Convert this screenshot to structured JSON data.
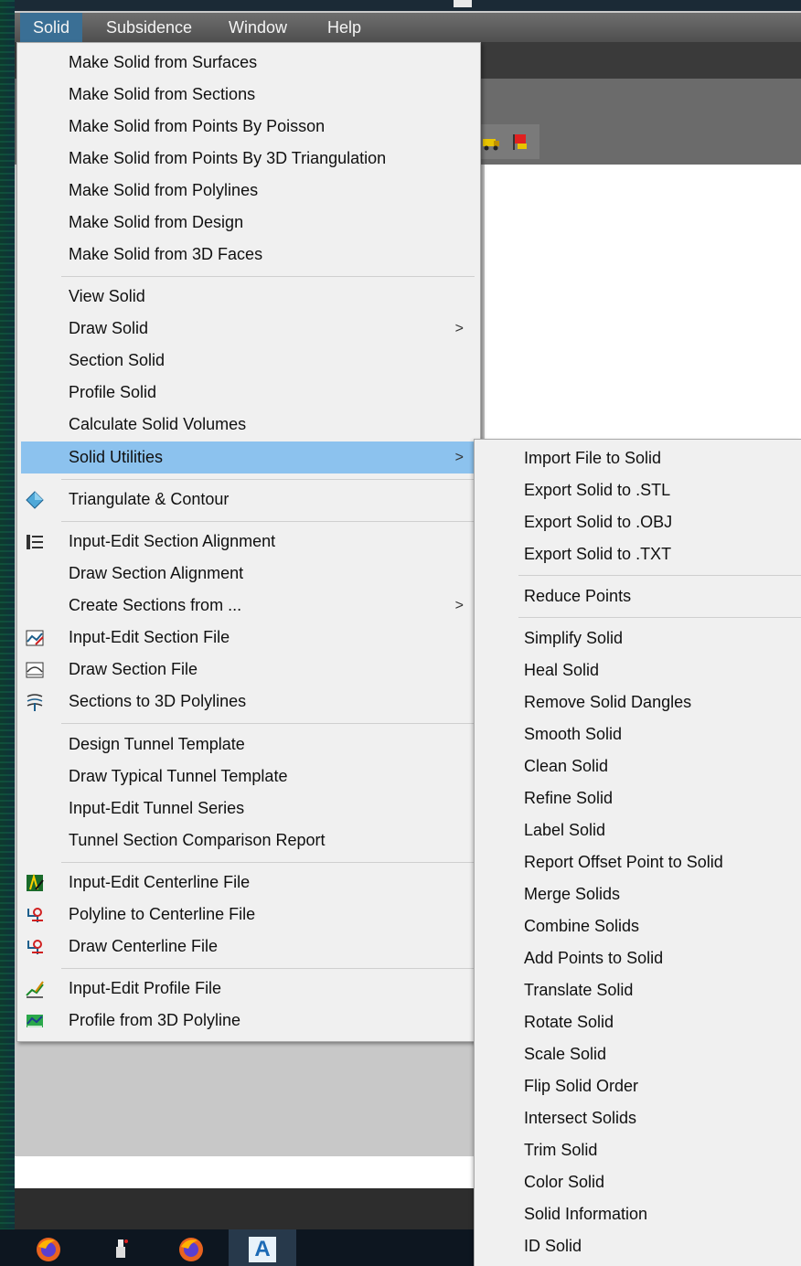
{
  "menubar": {
    "items": [
      "Solid",
      "Subsidence",
      "Window",
      "Help"
    ]
  },
  "solid_menu": {
    "items": [
      {
        "label": "Make Solid from Surfaces"
      },
      {
        "label": "Make Solid from Sections"
      },
      {
        "label": "Make Solid from Points By Poisson"
      },
      {
        "label": "Make Solid from Points By 3D Triangulation"
      },
      {
        "label": "Make Solid from Polylines"
      },
      {
        "label": "Make Solid from Design"
      },
      {
        "label": "Make Solid from 3D Faces"
      },
      {
        "label": "View Solid"
      },
      {
        "label": "Draw Solid",
        "submenu_arrow": ">"
      },
      {
        "label": "Section Solid"
      },
      {
        "label": "Profile Solid"
      },
      {
        "label": "Calculate Solid Volumes"
      },
      {
        "label": "Solid Utilities",
        "submenu_arrow": ">",
        "highlighted": true
      },
      {
        "label": "Triangulate & Contour",
        "icon": "triangulate-icon"
      },
      {
        "label": "Input-Edit Section Alignment",
        "icon": "section-alignment-icon"
      },
      {
        "label": "Draw Section Alignment"
      },
      {
        "label": "Create Sections from ...",
        "submenu_arrow": ">"
      },
      {
        "label": "Input-Edit Section File",
        "icon": "section-file-edit-icon"
      },
      {
        "label": "Draw Section File",
        "icon": "draw-section-file-icon"
      },
      {
        "label": "Sections to 3D Polylines",
        "icon": "sections-to-polylines-icon"
      },
      {
        "label": "Design Tunnel Template"
      },
      {
        "label": "Draw Typical Tunnel Template"
      },
      {
        "label": "Input-Edit Tunnel Series"
      },
      {
        "label": "Tunnel Section Comparison Report"
      },
      {
        "label": "Input-Edit Centerline File",
        "icon": "centerline-edit-icon"
      },
      {
        "label": "Polyline to Centerline File",
        "icon": "polyline-centerline-icon"
      },
      {
        "label": "Draw Centerline File",
        "icon": "draw-centerline-icon"
      },
      {
        "label": "Input-Edit Profile File",
        "icon": "profile-edit-icon"
      },
      {
        "label": "Profile from 3D Polyline",
        "icon": "profile-polyline-icon"
      }
    ]
  },
  "solid_utilities_submenu": {
    "items": [
      {
        "label": "Import File to Solid"
      },
      {
        "label": "Export Solid to .STL"
      },
      {
        "label": "Export Solid to .OBJ"
      },
      {
        "label": "Export Solid to .TXT"
      },
      {
        "label": "Reduce Points"
      },
      {
        "label": "Simplify Solid"
      },
      {
        "label": "Heal Solid"
      },
      {
        "label": "Remove Solid Dangles"
      },
      {
        "label": "Smooth Solid"
      },
      {
        "label": "Clean Solid"
      },
      {
        "label": "Refine Solid"
      },
      {
        "label": "Label Solid"
      },
      {
        "label": "Report Offset Point to Solid"
      },
      {
        "label": "Merge Solids"
      },
      {
        "label": "Combine Solids"
      },
      {
        "label": "Add Points to Solid"
      },
      {
        "label": "Translate Solid"
      },
      {
        "label": "Rotate Solid"
      },
      {
        "label": "Scale Solid"
      },
      {
        "label": "Flip Solid Order"
      },
      {
        "label": "Intersect Solids"
      },
      {
        "label": "Trim Solid"
      },
      {
        "label": "Color Solid"
      },
      {
        "label": "Solid Information"
      },
      {
        "label": "ID Solid"
      }
    ]
  },
  "taskbar": {
    "icons": [
      "firefox-icon",
      "app-icon",
      "firefox-icon",
      "autocad-icon"
    ],
    "autocad_letter": "A"
  },
  "colors": {
    "highlight": "#8cc2ee",
    "menu_bg": "#f0f0f0",
    "menubar_active": "#3a6f95"
  }
}
